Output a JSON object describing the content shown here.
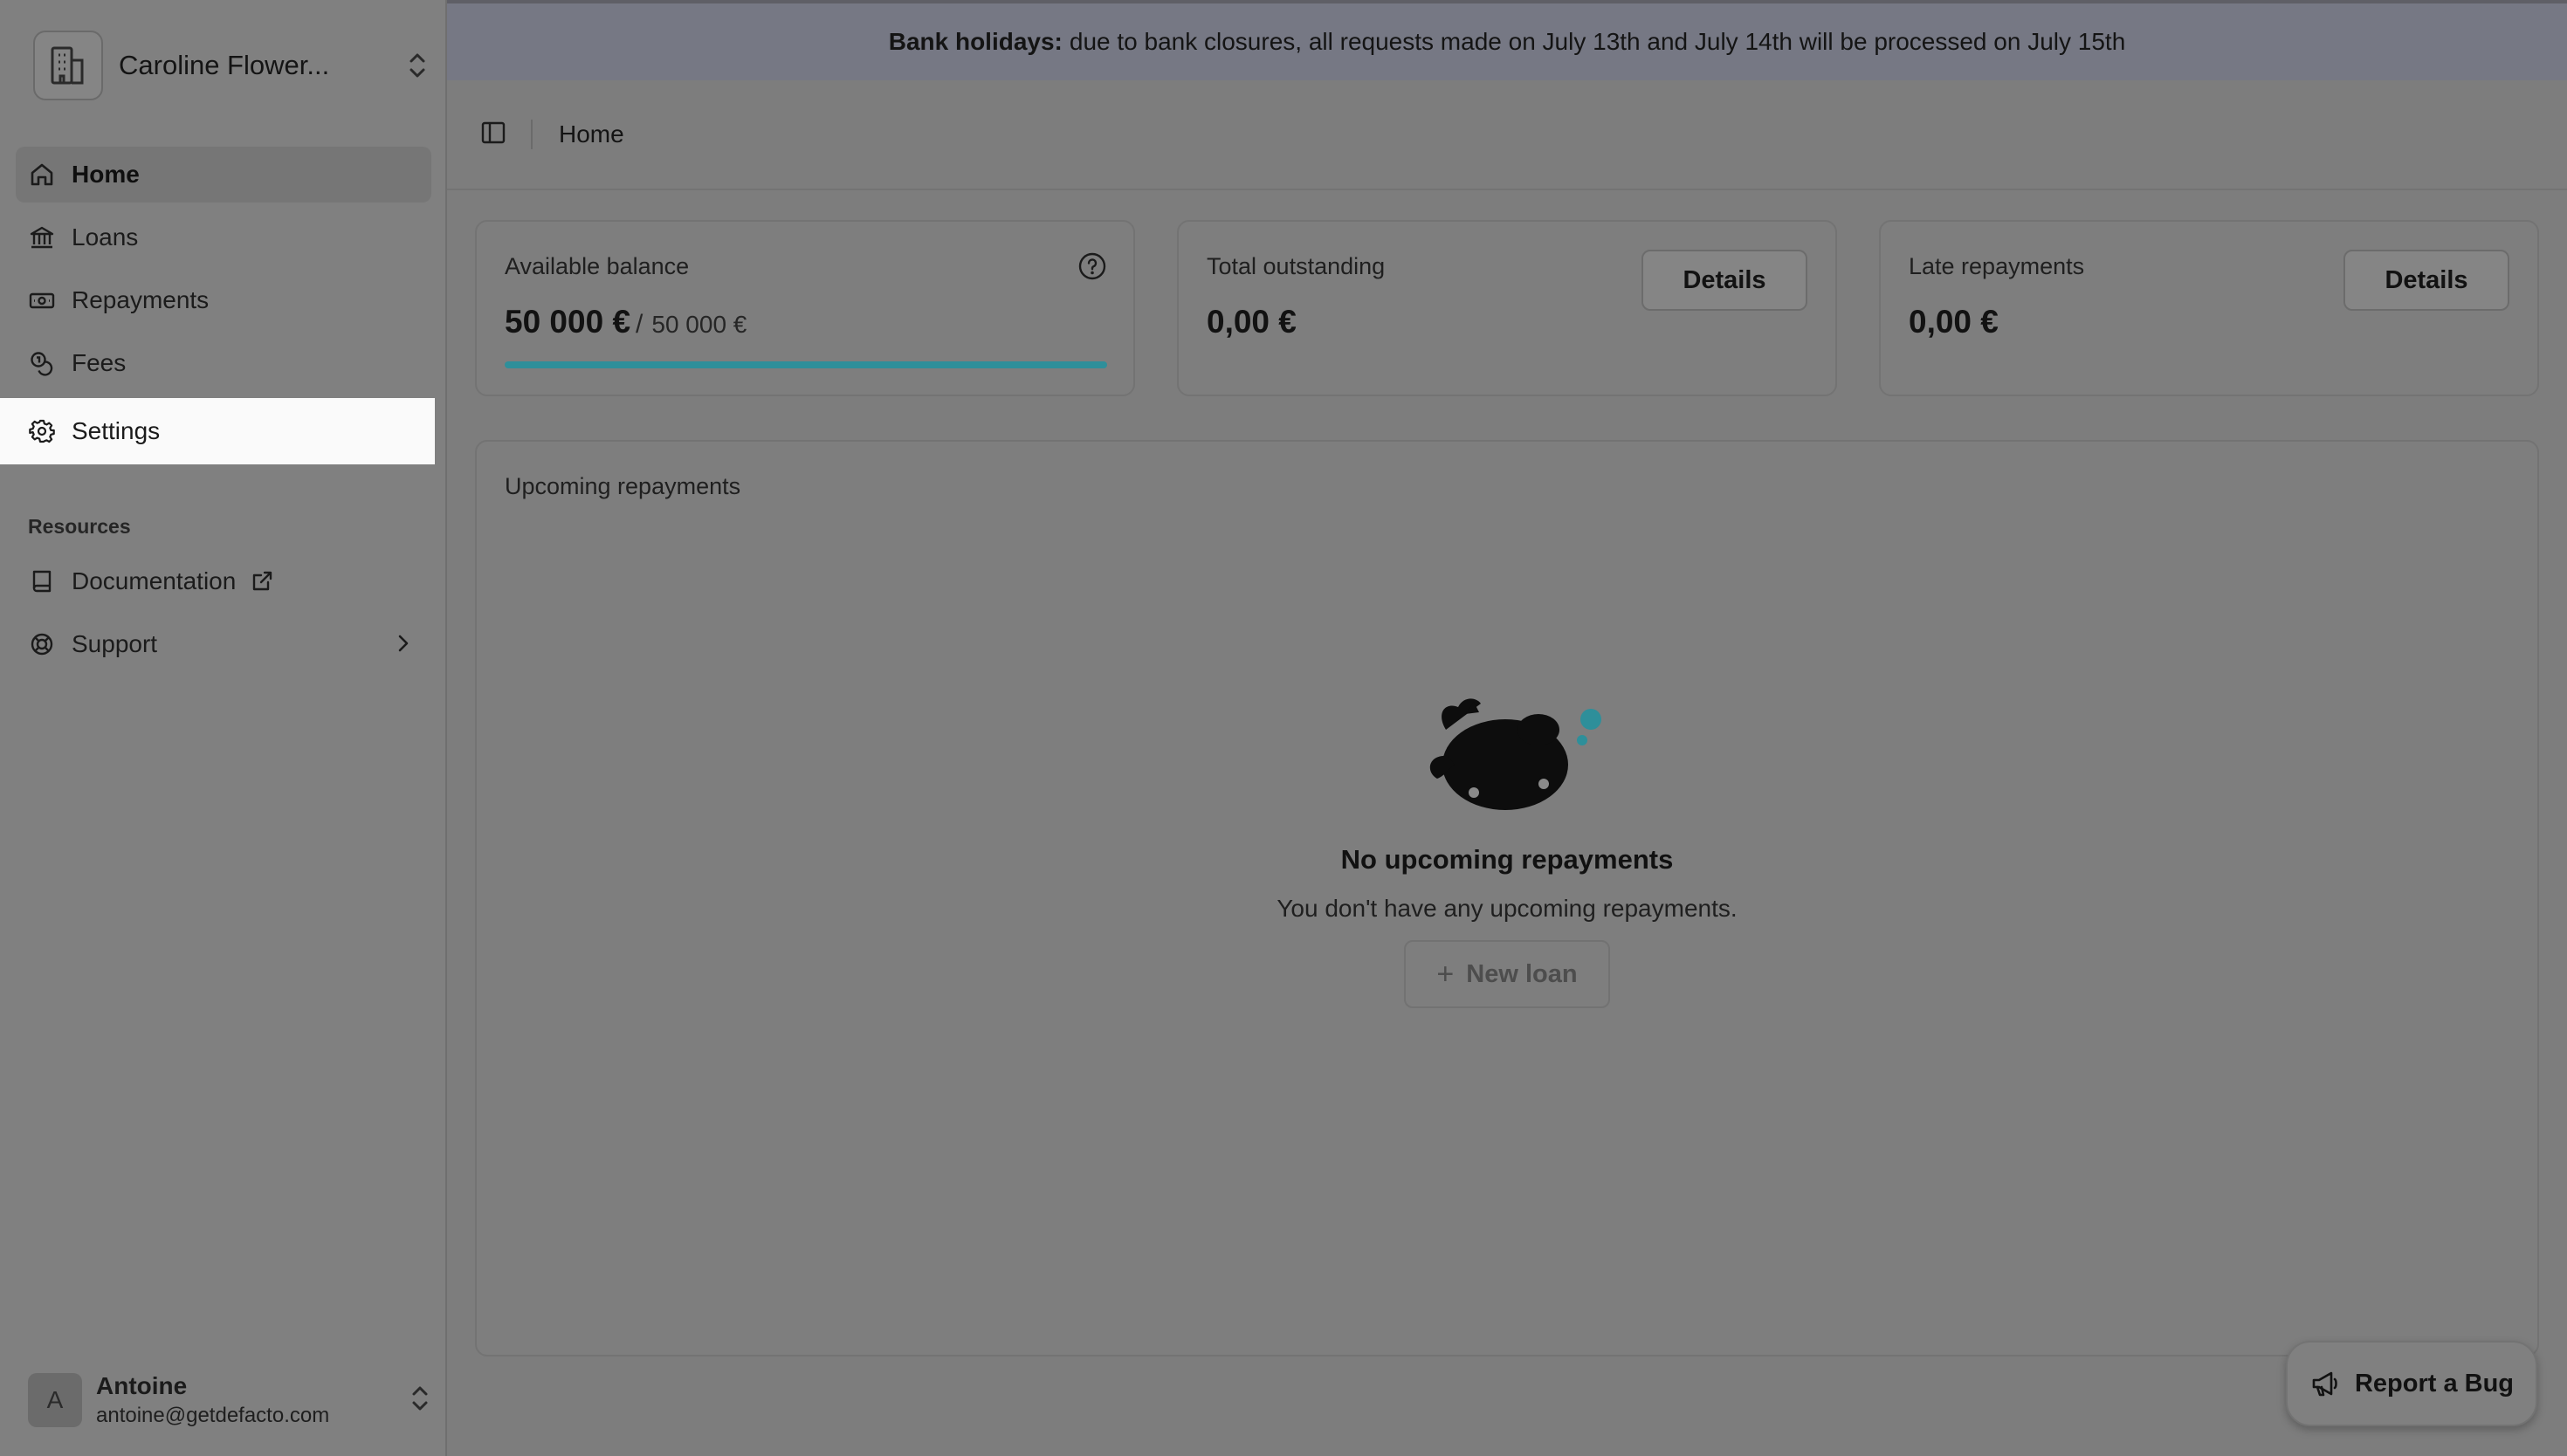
{
  "org": {
    "name": "Caroline Flower..."
  },
  "nav": {
    "items": [
      {
        "label": "Home",
        "icon": "home-icon",
        "active": true
      },
      {
        "label": "Loans",
        "icon": "bank-icon"
      },
      {
        "label": "Repayments",
        "icon": "banknote-icon"
      },
      {
        "label": "Fees",
        "icon": "coins-icon"
      },
      {
        "label": "Settings",
        "icon": "gear-icon",
        "highlighted": true
      }
    ]
  },
  "resources": {
    "label": "Resources",
    "items": [
      {
        "label": "Documentation",
        "icon": "book-icon",
        "external": true
      },
      {
        "label": "Support",
        "icon": "lifebuoy-icon",
        "has_submenu": true
      }
    ]
  },
  "user": {
    "initial": "A",
    "name": "Antoine",
    "email": "antoine@getdefacto.com"
  },
  "banner": {
    "bold": "Bank holidays:",
    "text": "due to bank closures, all requests made on July 13th and July 14th will be processed on July 15th"
  },
  "breadcrumb": {
    "current": "Home"
  },
  "cards": {
    "available_balance": {
      "label": "Available balance",
      "value": "50 000 €",
      "slash": "/",
      "limit": "50 000 €",
      "progress_fraction": 1.0
    },
    "total_outstanding": {
      "label": "Total outstanding",
      "value": "0,00 €",
      "button": "Details"
    },
    "late_repayments": {
      "label": "Late repayments",
      "value": "0,00 €",
      "button": "Details"
    }
  },
  "upcoming": {
    "title": "Upcoming repayments",
    "empty_title": "No upcoming repayments",
    "empty_subtitle": "You don't have any upcoming repayments.",
    "new_loan_plus": "+",
    "new_loan": "New loan"
  },
  "report_bug": {
    "label": "Report a Bug"
  },
  "colors": {
    "accent": "#2e8f9a",
    "banner_bg": "#767884",
    "highlight_bg": "#fafafa"
  }
}
